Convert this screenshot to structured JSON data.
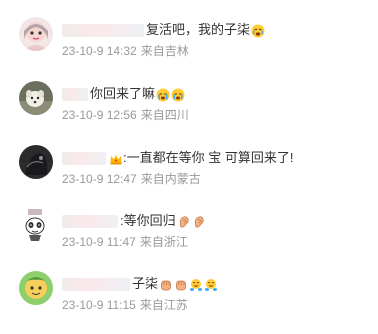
{
  "comments": [
    {
      "text": "复活吧，我的子柒",
      "emojis": [
        "crying-face-emoji"
      ],
      "date": "23-10-9 14:32",
      "location": "来自吉林",
      "avatar": "cartoon-girl"
    },
    {
      "text": "你回来了嘛",
      "emojis": [
        "sobbing-face-emoji",
        "sobbing-face-emoji"
      ],
      "date": "23-10-9 12:56",
      "location": "来自四川",
      "avatar": "dog-photo"
    },
    {
      "text": ":一直都在等你 宝 可算回来了!",
      "emojis": [
        "crown-emoji"
      ],
      "date": "23-10-9 12:47",
      "location": "来自内蒙古",
      "avatar": "dark-photo"
    },
    {
      "text": ":等你回归",
      "emojis": [
        "ear-emoji",
        "ear-emoji"
      ],
      "date": "23-10-9 11:47",
      "location": "来自浙江",
      "avatar": "panda-sketch"
    },
    {
      "text": "子柒",
      "emojis": [
        "fist-emoji",
        "fist-emoji",
        "crying-laughing-emoji",
        "crying-laughing-emoji"
      ],
      "date": "23-10-9 11:15",
      "location": "来自江苏",
      "avatar": "cartoon-character"
    }
  ],
  "colors": {
    "text": "#333333",
    "meta": "#999999",
    "background": "#ffffff"
  }
}
